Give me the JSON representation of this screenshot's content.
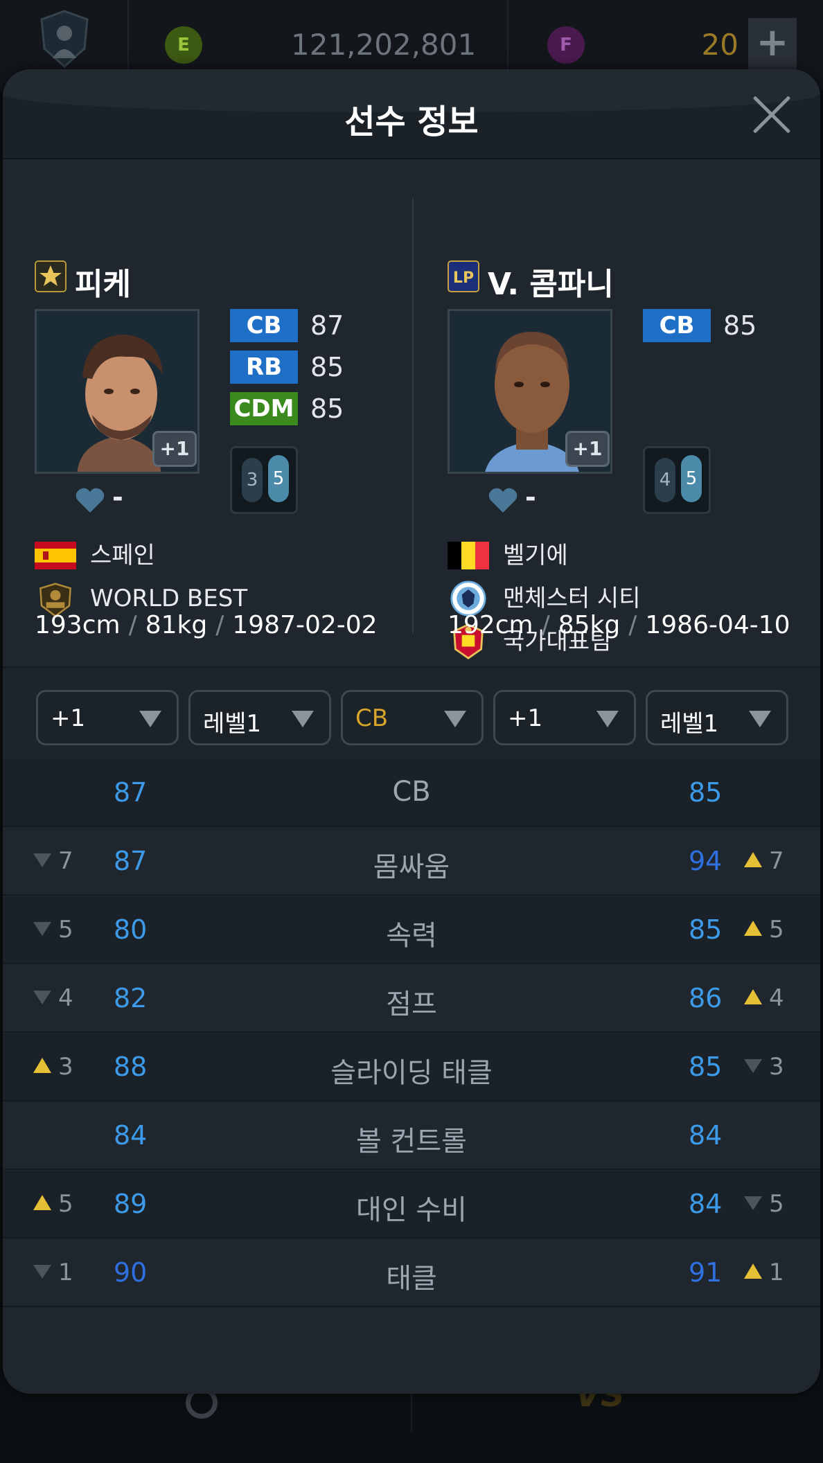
{
  "topbar": {
    "currency_e_label": "E",
    "money": "121,202,801",
    "currency_f_label": "F",
    "f_count": "20",
    "plus_label": "+"
  },
  "modal": {
    "title": "선수 정보"
  },
  "players": [
    {
      "name": "피케",
      "season_icon": "star-season-icon",
      "positions": [
        {
          "pos": "CB",
          "value": "87",
          "color": "#1f6fc7"
        },
        {
          "pos": "RB",
          "value": "85",
          "color": "#1f6fc7"
        },
        {
          "pos": "CDM",
          "value": "85",
          "color": "#3a8a1e"
        }
      ],
      "enhance_badge": "+1",
      "weak_foot": "3",
      "strong_foot": "5",
      "likes": "-",
      "nation": "스페인",
      "team": "WORLD BEST",
      "body": {
        "height": "193cm",
        "weight": "81kg",
        "birth": "1987-02-02"
      }
    },
    {
      "name": "V. 콤파니",
      "season_icon": "lp-season-icon",
      "positions": [
        {
          "pos": "CB",
          "value": "85",
          "color": "#1f6fc7"
        }
      ],
      "enhance_badge": "+1",
      "weak_foot": "4",
      "strong_foot": "5",
      "likes": "-",
      "nation": "벨기에",
      "club": "맨체스터 시티",
      "team": "국가대표팀",
      "body": {
        "height": "192cm",
        "weight": "85kg",
        "birth": "1986-04-10"
      }
    }
  ],
  "body_sep": "/",
  "selectors": [
    {
      "label": "+1"
    },
    {
      "label": "레벨1"
    },
    {
      "label": "CB"
    },
    {
      "label": "+1"
    },
    {
      "label": "레벨1"
    }
  ],
  "stats": [
    {
      "name": "CB",
      "left": "87",
      "right": "85",
      "ldiff": "",
      "ldir": "",
      "rdiff": "",
      "rdir": ""
    },
    {
      "name": "몸싸움",
      "left": "87",
      "right": "94",
      "ldiff": "7",
      "ldir": "down",
      "rdiff": "7",
      "rdir": "up"
    },
    {
      "name": "속력",
      "left": "80",
      "right": "85",
      "ldiff": "5",
      "ldir": "down",
      "rdiff": "5",
      "rdir": "up"
    },
    {
      "name": "점프",
      "left": "82",
      "right": "86",
      "ldiff": "4",
      "ldir": "down",
      "rdiff": "4",
      "rdir": "up"
    },
    {
      "name": "슬라이딩 태클",
      "left": "88",
      "right": "85",
      "ldiff": "3",
      "ldir": "up",
      "rdiff": "3",
      "rdir": "down"
    },
    {
      "name": "볼 컨트롤",
      "left": "84",
      "right": "84",
      "ldiff": "",
      "ldir": "",
      "rdiff": "",
      "rdir": ""
    },
    {
      "name": "대인 수비",
      "left": "89",
      "right": "84",
      "ldiff": "5",
      "ldir": "up",
      "rdiff": "5",
      "rdir": "down"
    },
    {
      "name": "태클",
      "left": "90",
      "right": "91",
      "ldiff": "1",
      "ldir": "down",
      "rdiff": "1",
      "rdir": "up"
    }
  ]
}
